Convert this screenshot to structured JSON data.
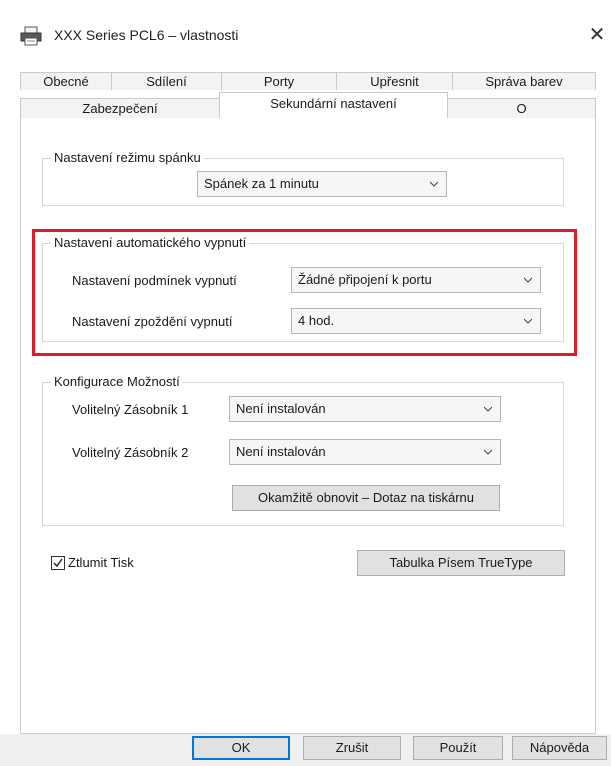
{
  "window": {
    "title": "XXX Series PCL6 – vlastnosti",
    "close_symbol": "✕",
    "icon": "printer-icon"
  },
  "tabs_back_row": [
    "Obecné",
    "Sdílení",
    "Porty",
    "Upřesnit",
    "Správa barev"
  ],
  "tabs_front_row": [
    "Zabezpečení",
    "Sekundární nastavení",
    "O"
  ],
  "selected_tab": "Sekundární nastavení",
  "sleep": {
    "legend": "Nastavení režimu spánku",
    "value": "Spánek za 1 minutu"
  },
  "auto_off": {
    "legend": "Nastavení automatického vypnutí",
    "condition_label": "Nastavení podmínek vypnutí",
    "condition_value": "Žádné připojení k portu",
    "delay_label": "Nastavení zpoždění vypnutí",
    "delay_value": "4 hod.",
    "highlight_color": "#d61f26"
  },
  "options": {
    "legend": "Konfigurace Možností",
    "tray1_label": "Volitelný Zásobník 1",
    "tray1_value": "Není instalován",
    "tray2_label": "Volitelný Zásobník 2",
    "tray2_value": "Není instalován",
    "refresh_button": "Okamžitě obnovit – Dotaz na tiskárnu"
  },
  "mute": {
    "label": "Ztlumit Tisk",
    "checked": true
  },
  "truetype_button": "Tabulka Písem TrueType",
  "footer": {
    "ok": "OK",
    "cancel": "Zrušit",
    "apply": "Použít",
    "help": "Nápověda"
  }
}
